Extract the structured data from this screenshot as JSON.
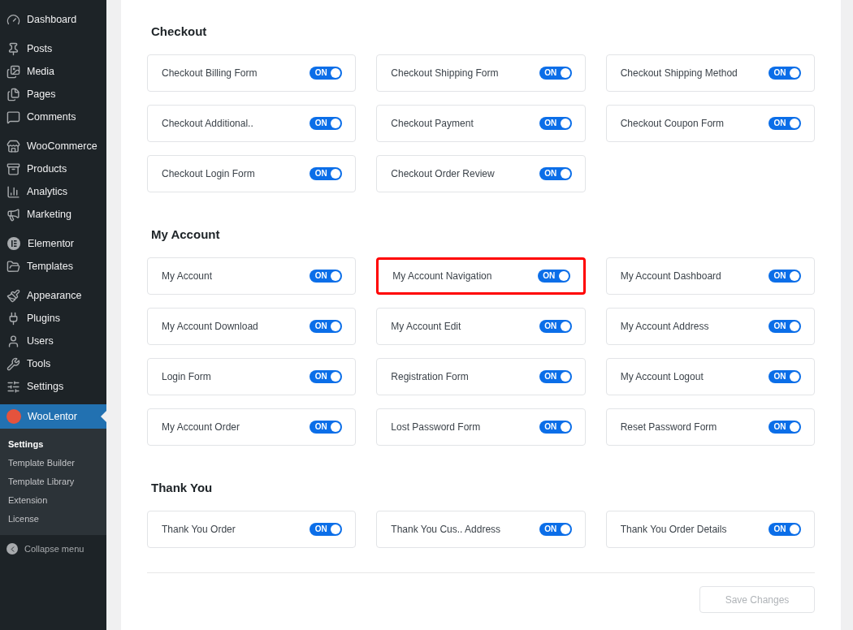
{
  "sidebar": {
    "groups": [
      [
        {
          "label": "Dashboard",
          "kind": "gauge",
          "selected": false
        }
      ],
      [
        {
          "label": "Posts",
          "kind": "pin",
          "selected": false
        },
        {
          "label": "Media",
          "kind": "media",
          "selected": false
        },
        {
          "label": "Pages",
          "kind": "pages",
          "selected": false
        },
        {
          "label": "Comments",
          "kind": "comment",
          "selected": false
        }
      ],
      [
        {
          "label": "WooCommerce",
          "kind": "store",
          "selected": false
        },
        {
          "label": "Products",
          "kind": "archive",
          "selected": false
        },
        {
          "label": "Analytics",
          "kind": "chart",
          "selected": false
        },
        {
          "label": "Marketing",
          "kind": "megaphone",
          "selected": false
        }
      ],
      [
        {
          "label": "Elementor",
          "kind": "elementor",
          "selected": false
        },
        {
          "label": "Templates",
          "kind": "folder",
          "selected": false
        }
      ],
      [
        {
          "label": "Appearance",
          "kind": "brush",
          "selected": false
        },
        {
          "label": "Plugins",
          "kind": "plug",
          "selected": false
        },
        {
          "label": "Users",
          "kind": "user",
          "selected": false
        },
        {
          "label": "Tools",
          "kind": "wrench",
          "selected": false
        },
        {
          "label": "Settings",
          "kind": "sliders",
          "selected": false
        }
      ],
      [
        {
          "label": "WooLentor",
          "kind": "logo",
          "selected": true
        }
      ]
    ],
    "submenu": [
      {
        "label": "Settings",
        "selected": true
      },
      {
        "label": "Template Builder",
        "selected": false
      },
      {
        "label": "Template Library",
        "selected": false
      },
      {
        "label": "Extension",
        "selected": false
      },
      {
        "label": "License",
        "selected": false
      }
    ],
    "collapse": "Collapse menu"
  },
  "sections": [
    {
      "title": "Checkout",
      "items": [
        {
          "label": "Checkout Billing Form",
          "switch": "ON",
          "on": true,
          "highlighted": false
        },
        {
          "label": "Checkout Shipping Form",
          "switch": "ON",
          "on": true,
          "highlighted": false
        },
        {
          "label": "Checkout Shipping Method",
          "switch": "ON",
          "on": true,
          "highlighted": false
        },
        {
          "label": "Checkout Additional..",
          "switch": "ON",
          "on": true,
          "highlighted": false
        },
        {
          "label": "Checkout Payment",
          "switch": "ON",
          "on": true,
          "highlighted": false
        },
        {
          "label": "Checkout Coupon Form",
          "switch": "ON",
          "on": true,
          "highlighted": false
        },
        {
          "label": "Checkout Login Form",
          "switch": "ON",
          "on": true,
          "highlighted": false
        },
        {
          "label": "Checkout Order Review",
          "switch": "ON",
          "on": true,
          "highlighted": false
        }
      ]
    },
    {
      "title": "My Account",
      "items": [
        {
          "label": "My Account",
          "switch": "ON",
          "on": true,
          "highlighted": false
        },
        {
          "label": "My Account Navigation",
          "switch": "ON",
          "on": true,
          "highlighted": true
        },
        {
          "label": "My Account Dashboard",
          "switch": "ON",
          "on": true,
          "highlighted": false
        },
        {
          "label": "My Account Download",
          "switch": "ON",
          "on": true,
          "highlighted": false
        },
        {
          "label": "My Account Edit",
          "switch": "ON",
          "on": true,
          "highlighted": false
        },
        {
          "label": "My Account Address",
          "switch": "ON",
          "on": true,
          "highlighted": false
        },
        {
          "label": "Login Form",
          "switch": "ON",
          "on": true,
          "highlighted": false
        },
        {
          "label": "Registration Form",
          "switch": "ON",
          "on": true,
          "highlighted": false
        },
        {
          "label": "My Account Logout",
          "switch": "ON",
          "on": true,
          "highlighted": false
        },
        {
          "label": "My Account Order",
          "switch": "ON",
          "on": true,
          "highlighted": false
        },
        {
          "label": "Lost Password Form",
          "switch": "ON",
          "on": true,
          "highlighted": false
        },
        {
          "label": "Reset Password Form",
          "switch": "ON",
          "on": true,
          "highlighted": false
        }
      ]
    },
    {
      "title": "Thank You",
      "items": [
        {
          "label": "Thank You Order",
          "switch": "ON",
          "on": true,
          "highlighted": false
        },
        {
          "label": "Thank You Cus.. Address",
          "switch": "ON",
          "on": true,
          "highlighted": false
        },
        {
          "label": "Thank You Order Details",
          "switch": "ON",
          "on": true,
          "highlighted": false
        }
      ]
    }
  ],
  "save_button": {
    "label": "Save Changes",
    "disabled": true
  }
}
